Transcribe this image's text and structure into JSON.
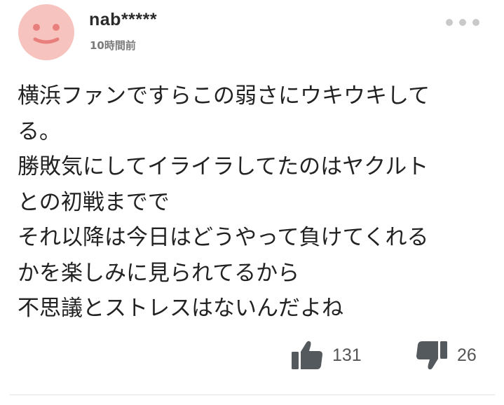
{
  "comment": {
    "username": "nab*****",
    "timestamp": "10時間前",
    "avatar_icon": "smiley-face-icon",
    "avatar_color": "#f7c3bf",
    "more_icon": "more-dots-icon",
    "body_lines": [
      "横浜ファンですらこの弱さにウキウキして",
      "る。",
      "勝敗気にしてイライラしてたのはヤクルト",
      "との初戦までで",
      "それ以降は今日はどうやって負けてくれる",
      "かを楽しみに見られてるから",
      "不思議とストレスはないんだよね"
    ],
    "reactions": {
      "like_icon": "thumbs-up-icon",
      "like_count": "131",
      "dislike_icon": "thumbs-down-icon",
      "dislike_count": "26",
      "icon_color": "#54595e"
    }
  }
}
